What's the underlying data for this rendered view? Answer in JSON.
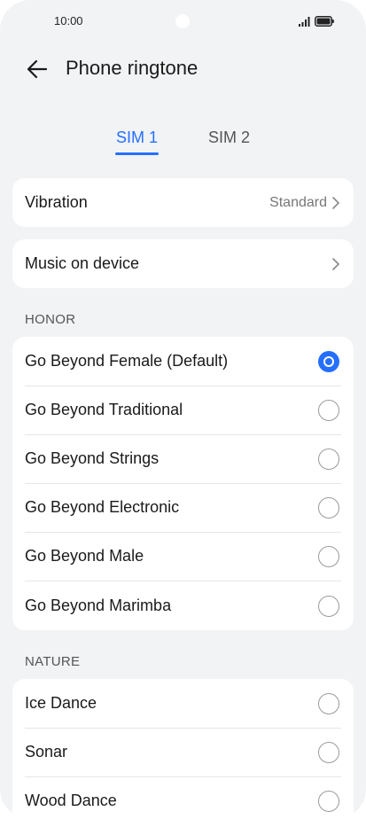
{
  "status_bar": {
    "time": "10:00"
  },
  "header": {
    "title": "Phone ringtone"
  },
  "tabs": [
    {
      "label": "SIM 1",
      "selected": true
    },
    {
      "label": "SIM 2",
      "selected": false
    }
  ],
  "vibration": {
    "label": "Vibration",
    "value": "Standard"
  },
  "music": {
    "label": "Music on device"
  },
  "sections": [
    {
      "title": "HONOR",
      "items": [
        {
          "label": "Go Beyond Female (Default)",
          "selected": true
        },
        {
          "label": "Go Beyond Traditional",
          "selected": false
        },
        {
          "label": "Go Beyond Strings",
          "selected": false
        },
        {
          "label": "Go Beyond Electronic",
          "selected": false
        },
        {
          "label": "Go Beyond Male",
          "selected": false
        },
        {
          "label": "Go Beyond Marimba",
          "selected": false
        }
      ]
    },
    {
      "title": "NATURE",
      "items": [
        {
          "label": "Ice Dance",
          "selected": false
        },
        {
          "label": "Sonar",
          "selected": false
        },
        {
          "label": "Wood Dance",
          "selected": false
        }
      ]
    }
  ],
  "colors": {
    "accent": "#256fff",
    "background": "#f1f3f5",
    "card": "#ffffff"
  }
}
